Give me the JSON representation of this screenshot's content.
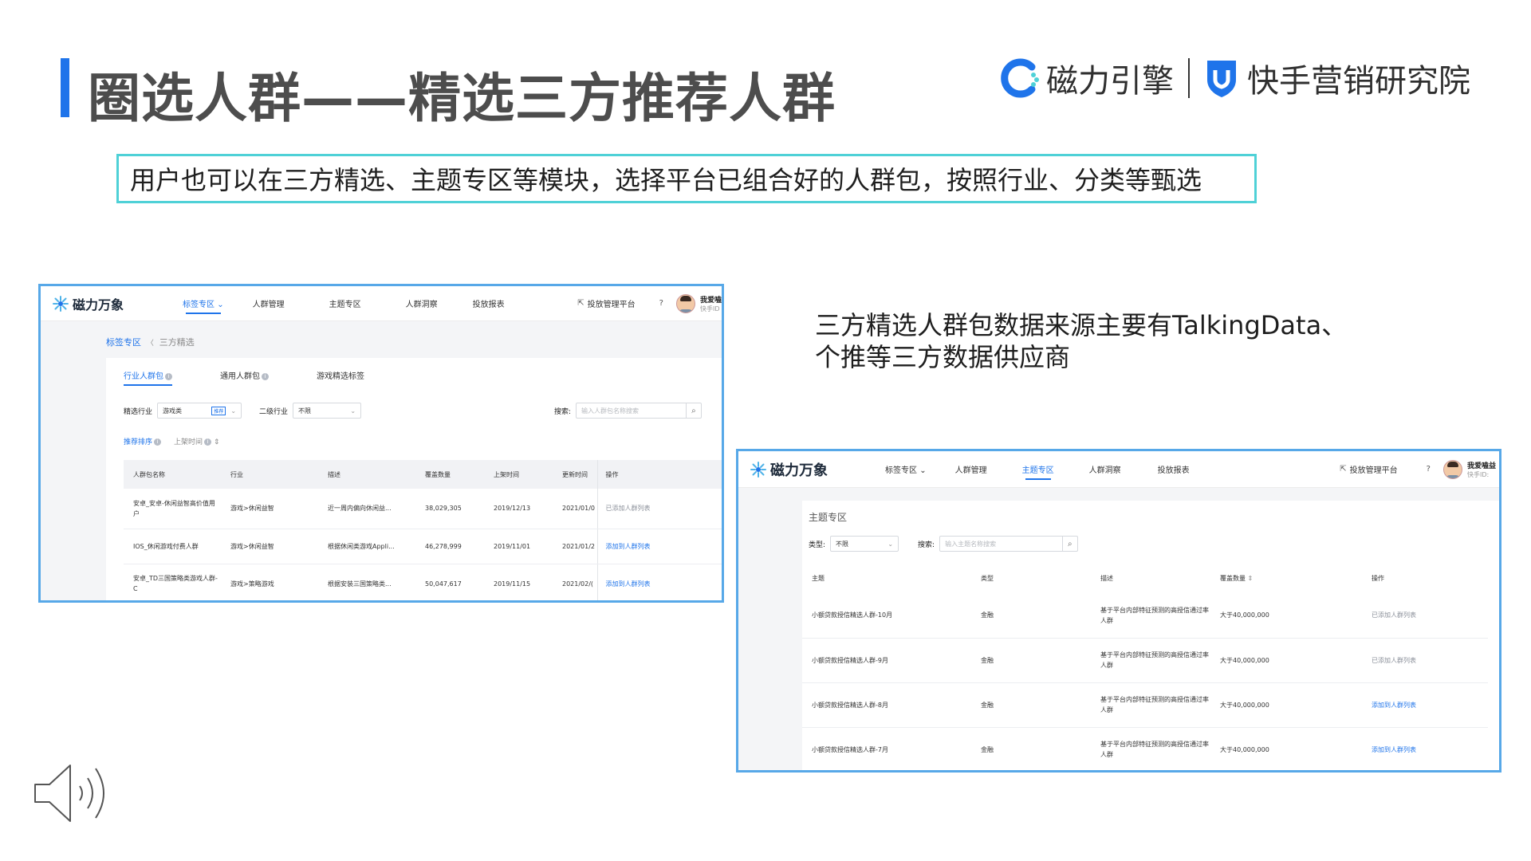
{
  "slide": {
    "title": "圈选人群——精选三方推荐人群",
    "logo1_text": "磁力引擎",
    "logo2_text": "快手营销研究院",
    "subtitle": "用户也可以在三方精选、主题专区等模块，选择平台已组合好的人群包，按照行业、分类等甄选",
    "side_note_line1": "三方精选人群包数据来源主要有TalkingData、",
    "side_note_line2": "个推等三方数据供应商"
  },
  "colors": {
    "accent": "#1f74ea",
    "frame": "#57a8e8",
    "subtitle_border": "#4fd1d7"
  },
  "app1": {
    "brand": "磁力万象",
    "nav": [
      "标签专区",
      "人群管理",
      "主题专区",
      "人群洞察",
      "投放报表"
    ],
    "nav_active": "标签专区",
    "platform": "投放管理平台",
    "user_name": "我爱嗑",
    "user_id": "快手ID",
    "breadcrumb_root": "标签专区",
    "breadcrumb_sep": "〈",
    "breadcrumb_current": "三方精选",
    "tabs": [
      "行业人群包",
      "通用人群包",
      "游戏精选标签"
    ],
    "filter_industry_label": "精选行业",
    "filter_industry_value": "游戏类",
    "filter_industry_tag": "推荐",
    "filter_sub_label": "二级行业",
    "filter_sub_value": "不限",
    "search_label": "搜索:",
    "search_placeholder": "输入人群包名称搜索",
    "sort_recommend": "推荐排序",
    "sort_time": "上架时间",
    "headers": [
      "人群包名称",
      "行业",
      "描述",
      "覆盖数量",
      "上架时间",
      "更新时间",
      "操作"
    ],
    "rows": [
      {
        "name": "安卓_安卓-休闲益智高价值用户",
        "industry": "游戏>休闲益智",
        "desc": "近一周内偏向休闲益...",
        "count": "38,029,305",
        "listed": "2019/12/13",
        "updated": "2021/01/0",
        "op": "已添加人群列表",
        "done": true
      },
      {
        "name": "IOS_休闲游戏付费人群",
        "industry": "游戏>休闲益智",
        "desc": "根据休闲类游戏Appli...",
        "count": "46,278,999",
        "listed": "2019/11/01",
        "updated": "2021/01/2",
        "op": "添加到人群列表",
        "done": false
      },
      {
        "name": "安卓_TD三国策略类游戏人群-C",
        "industry": "游戏>策略游戏",
        "desc": "根据安装三国策略类...",
        "count": "50,047,617",
        "listed": "2019/11/15",
        "updated": "2021/02/(",
        "op": "添加到人群列表",
        "done": false
      }
    ]
  },
  "app2": {
    "brand": "磁力万象",
    "nav": [
      "标签专区",
      "人群管理",
      "主题专区",
      "人群洞察",
      "投放报表"
    ],
    "nav_active": "主题专区",
    "platform": "投放管理平台",
    "user_name": "我爱嗑益",
    "user_id": "快手ID:",
    "page_title": "主题专区",
    "type_label": "类型:",
    "type_value": "不限",
    "search_label": "搜索:",
    "search_placeholder": "输入主题名称搜索",
    "headers": [
      "主题",
      "类型",
      "描述",
      "覆盖数量",
      "操作"
    ],
    "rows": [
      {
        "theme": "小额贷款授信精选人群-10月",
        "type": "金融",
        "desc": "基于平台内部特征预测的高授信通过率人群",
        "count": "大于40,000,000",
        "op": "已添加人群列表",
        "done": true
      },
      {
        "theme": "小额贷款授信精选人群-9月",
        "type": "金融",
        "desc": "基于平台内部特征预测的高授信通过率人群",
        "count": "大于40,000,000",
        "op": "已添加人群列表",
        "done": true
      },
      {
        "theme": "小额贷款授信精选人群-8月",
        "type": "金融",
        "desc": "基于平台内部特征预测的高授信通过率人群",
        "count": "大于40,000,000",
        "op": "添加到人群列表",
        "done": false
      },
      {
        "theme": "小额贷款授信精选人群-7月",
        "type": "金融",
        "desc": "基于平台内部特征预测的高授信通过率人群",
        "count": "大于40,000,000",
        "op": "添加到人群列表",
        "done": false
      }
    ]
  }
}
